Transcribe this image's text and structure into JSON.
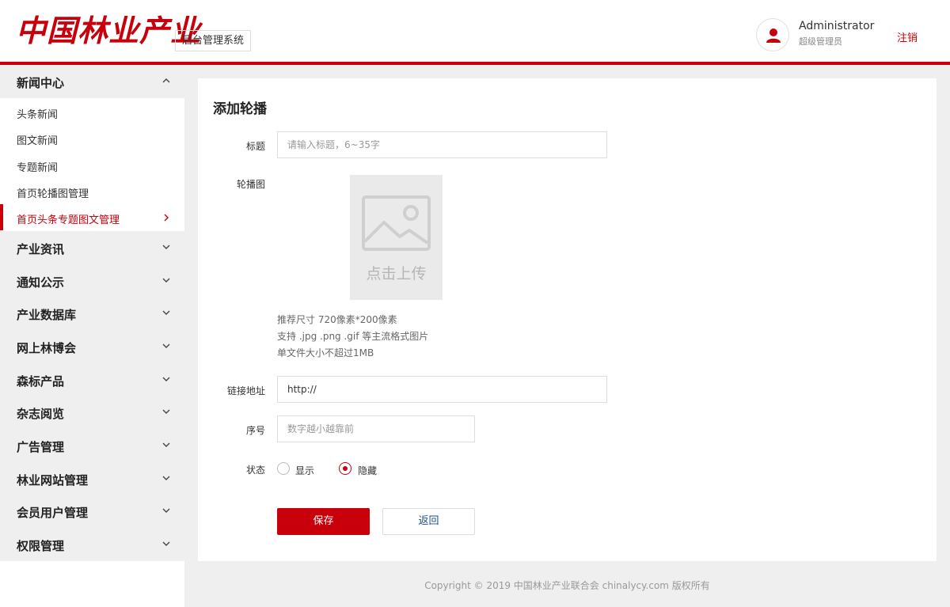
{
  "header": {
    "logo_text": "中国林业产业",
    "system_name": "后台管理系统",
    "user": {
      "name": "Administrator",
      "role": "超级管理员"
    },
    "logout_label": "注销",
    "accent_color": "#c8000b"
  },
  "sidebar": {
    "groups": [
      {
        "label": "新闻中心",
        "expanded": true,
        "icon": "chevron-up-icon"
      },
      {
        "label": "产业资讯",
        "icon": "chevron-down-icon"
      },
      {
        "label": "通知公示",
        "icon": "chevron-down-icon"
      },
      {
        "label": "产业数据库",
        "icon": "chevron-down-icon"
      },
      {
        "label": "网上林博会",
        "icon": "chevron-down-icon"
      },
      {
        "label": "森标产品",
        "icon": "chevron-down-icon"
      },
      {
        "label": "杂志阅览",
        "icon": "chevron-down-icon"
      },
      {
        "label": "广告管理",
        "icon": "chevron-down-icon"
      },
      {
        "label": "林业网站管理",
        "icon": "chevron-down-icon"
      },
      {
        "label": "会员用户管理",
        "icon": "chevron-down-icon"
      },
      {
        "label": "权限管理",
        "icon": "chevron-down-icon"
      }
    ],
    "sub_items": [
      {
        "label": "头条新闻"
      },
      {
        "label": "图文新闻"
      },
      {
        "label": "专题新闻"
      },
      {
        "label": "首页轮播图管理"
      },
      {
        "label": "首页头条专题图文管理",
        "active": true,
        "icon": "chevron-right-icon"
      }
    ]
  },
  "form": {
    "title": "添加轮播",
    "title_field": {
      "label": "标题",
      "placeholder": "请输入标题，6~35字"
    },
    "image_field": {
      "label": "轮播图",
      "upload_text": "点击上传",
      "icon": "image-placeholder-icon",
      "hints": [
        "推荐尺寸 720像素*200像素",
        "支持 .jpg .png .gif 等主流格式图片",
        "单文件大小不超过1MB"
      ]
    },
    "link_field": {
      "label": "链接地址",
      "value": "http://"
    },
    "order_field": {
      "label": "序号",
      "placeholder": "数字越小越靠前"
    },
    "status_field": {
      "label": "状态",
      "options": [
        {
          "label": "显示",
          "checked": false
        },
        {
          "label": "隐藏",
          "checked": true
        }
      ]
    },
    "save_label": "保存",
    "back_label": "返回"
  },
  "footer": {
    "copyright": "Copyright © 2019 中国林业产业联合会 chinalycy.com 版权所有"
  }
}
